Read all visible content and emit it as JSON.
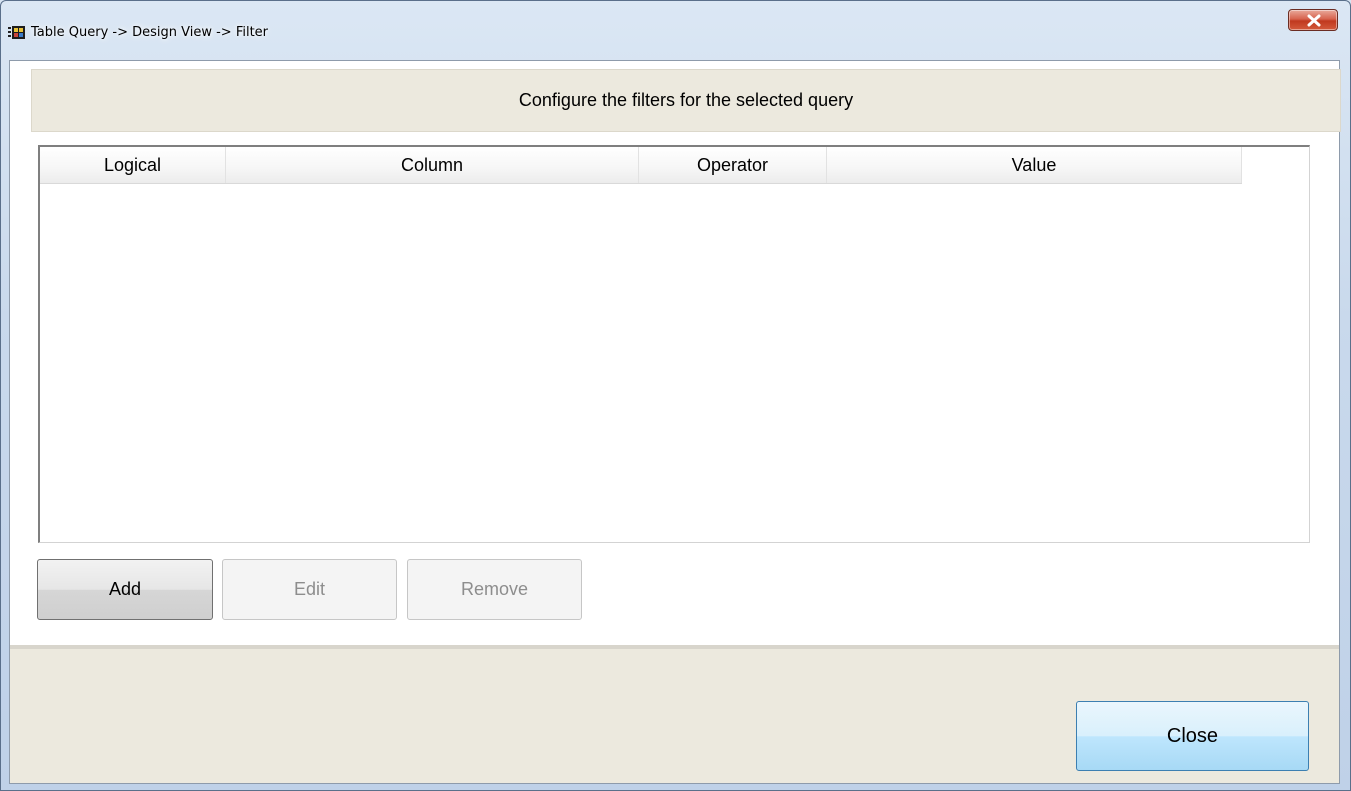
{
  "window": {
    "title": "Table Query -> Design View -> Filter",
    "icon": "app-table-icon",
    "close_icon": "close-icon"
  },
  "banner": {
    "text": "Configure the filters for the selected query"
  },
  "grid": {
    "columns": [
      "Logical",
      "Column",
      "Operator",
      "Value"
    ],
    "rows": []
  },
  "buttons": {
    "add": "Add",
    "edit": "Edit",
    "remove": "Remove",
    "close": "Close"
  },
  "colors": {
    "close_button": "#c0391f",
    "banner_bg": "#ece9de",
    "primary_button": "#bee6fd"
  }
}
